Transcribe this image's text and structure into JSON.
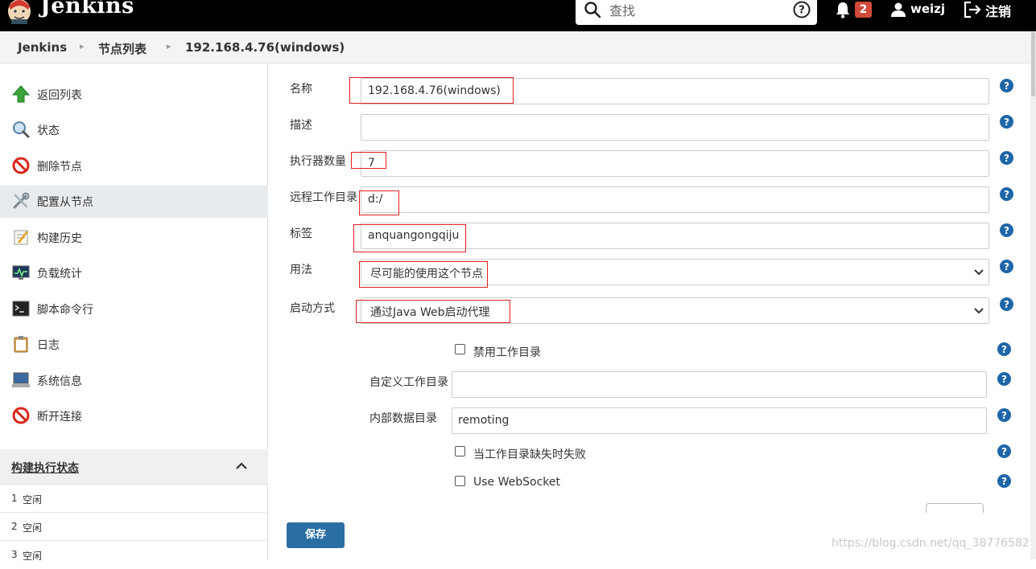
{
  "header": {
    "brand": "Jenkins",
    "search_placeholder": "查找",
    "notification_count": "2",
    "user": "weizj",
    "logout": "注销"
  },
  "breadcrumb": [
    "Jenkins",
    "节点列表",
    "192.168.4.76(windows)"
  ],
  "sidebar": {
    "items": [
      {
        "label": "返回列表",
        "icon": "up-arrow-icon"
      },
      {
        "label": "状态",
        "icon": "magnifier-icon"
      },
      {
        "label": "删除节点",
        "icon": "no-entry-icon"
      },
      {
        "label": "配置从节点",
        "icon": "tools-icon"
      },
      {
        "label": "构建历史",
        "icon": "notepad-icon"
      },
      {
        "label": "负载统计",
        "icon": "monitor-chart-icon"
      },
      {
        "label": "脚本命令行",
        "icon": "terminal-icon"
      },
      {
        "label": "日志",
        "icon": "clipboard-icon"
      },
      {
        "label": "系统信息",
        "icon": "computer-icon"
      },
      {
        "label": "断开连接",
        "icon": "no-entry-icon"
      }
    ],
    "executor_panel": {
      "title": "构建执行状态",
      "rows": [
        {
          "num": "1",
          "status": "空闲"
        },
        {
          "num": "2",
          "status": "空闲"
        },
        {
          "num": "3",
          "status": "空闲"
        }
      ]
    }
  },
  "form": {
    "name": {
      "label": "名称",
      "value": "192.168.4.76(windows)"
    },
    "description": {
      "label": "描述",
      "value": ""
    },
    "executors": {
      "label": "执行器数量",
      "value": "7"
    },
    "remote_root": {
      "label": "远程工作目录",
      "value": "d:/"
    },
    "labels": {
      "label": "标签",
      "value": "anquangongqiju"
    },
    "usage": {
      "label": "用法",
      "value": "尽可能的使用这个节点"
    },
    "launch": {
      "label": "启动方式",
      "value": "通过Java Web启动代理"
    },
    "disable_workdir": {
      "label": "禁用工作目录",
      "checked": false
    },
    "custom_workdir": {
      "label": "自定义工作目录",
      "value": ""
    },
    "internal_dir": {
      "label": "内部数据目录",
      "value": "remoting"
    },
    "fail_if_missing": {
      "label": "当工作目录缺失时失败",
      "checked": false
    },
    "websocket": {
      "label": "Use WebSocket",
      "checked": false
    },
    "save": "保存"
  },
  "watermark": "https://blog.csdn.net/qq_38776582"
}
